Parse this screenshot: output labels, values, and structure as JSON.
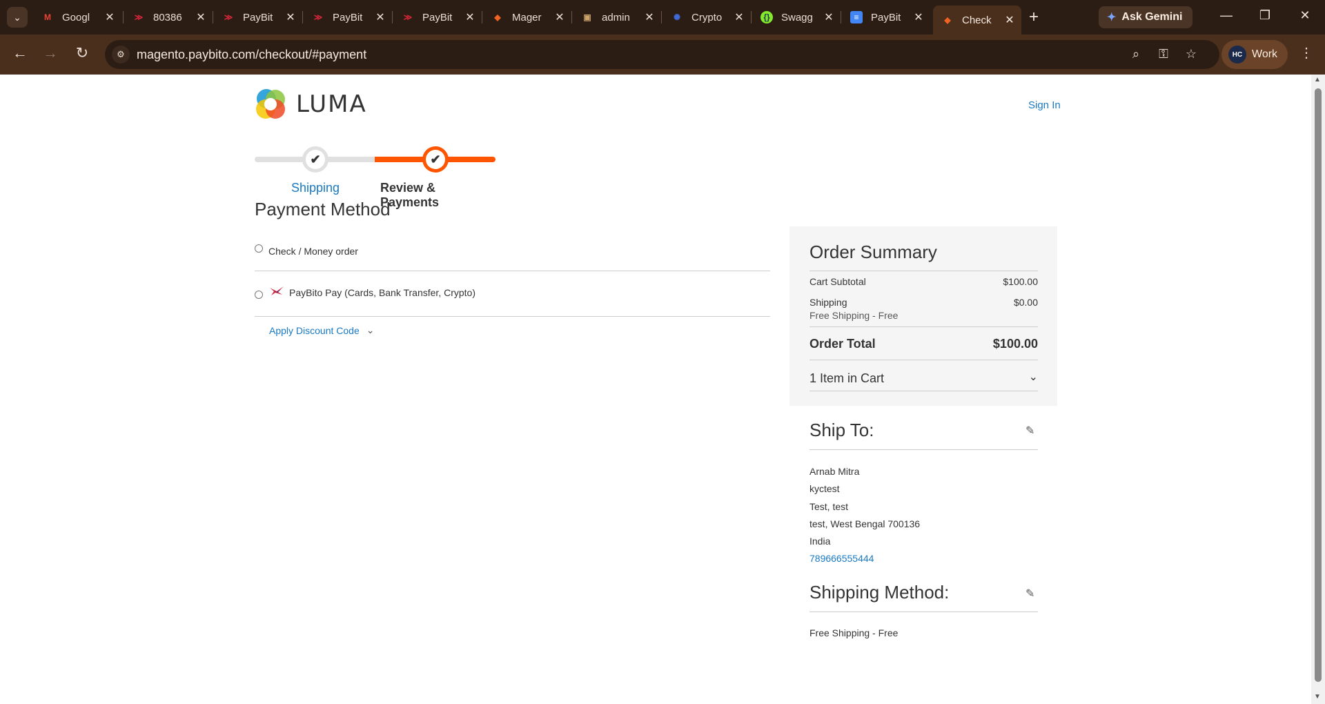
{
  "browser": {
    "tabs": [
      {
        "title": "Googl",
        "icon": "gmail-icon",
        "color": "#ea4335"
      },
      {
        "title": "80386",
        "icon": "paybito-icon",
        "color": "#d8263a"
      },
      {
        "title": "PayBit",
        "icon": "paybito-icon",
        "color": "#d8263a"
      },
      {
        "title": "PayBit",
        "icon": "paybito-icon",
        "color": "#d8263a"
      },
      {
        "title": "PayBit",
        "icon": "paybito-icon",
        "color": "#d8263a"
      },
      {
        "title": "Mager",
        "icon": "magento-icon",
        "color": "#f26322"
      },
      {
        "title": "admin",
        "icon": "admin-icon",
        "color": "#c9a36a"
      },
      {
        "title": "Crypto",
        "icon": "crypto-icon",
        "color": "#3f6ad8"
      },
      {
        "title": "Swagg",
        "icon": "swagger-icon",
        "color": "#85ea2d"
      },
      {
        "title": "PayBit",
        "icon": "docs-icon",
        "color": "#4285f4"
      },
      {
        "title": "Check",
        "icon": "magento-icon",
        "color": "#f26322"
      }
    ],
    "gemini_label": "Ask Gemini",
    "url": "magento.paybito.com/checkout/#payment",
    "profile_label": "Work"
  },
  "header": {
    "logo_text": "LUMA",
    "signin_label": "Sign In"
  },
  "progress": {
    "step1_label": "Shipping",
    "step2_label": "Review & Payments"
  },
  "payment": {
    "title": "Payment Method",
    "option1_label": "Check / Money order",
    "option2_label": "PayBito Pay (Cards, Bank Transfer, Crypto)",
    "discount_label": "Apply Discount Code"
  },
  "summary": {
    "title": "Order Summary",
    "subtotal_label": "Cart Subtotal",
    "subtotal_value": "$100.00",
    "shipping_label": "Shipping",
    "shipping_value": "$0.00",
    "shipping_method": "Free Shipping - Free",
    "total_label": "Order Total",
    "total_value": "$100.00",
    "items_label": "1 Item in Cart"
  },
  "ship_to": {
    "title": "Ship To:",
    "name": "Arnab Mitra",
    "line2": "kyctest",
    "line3": "Test, test",
    "line4": "test, West Bengal 700136",
    "country": "India",
    "phone": "789666555444"
  },
  "shipping_method": {
    "title": "Shipping Method:",
    "value": "Free Shipping - Free"
  },
  "colors": {
    "accent": "#ff5501",
    "link": "#1979c3",
    "chrome": "#2b1d14"
  }
}
